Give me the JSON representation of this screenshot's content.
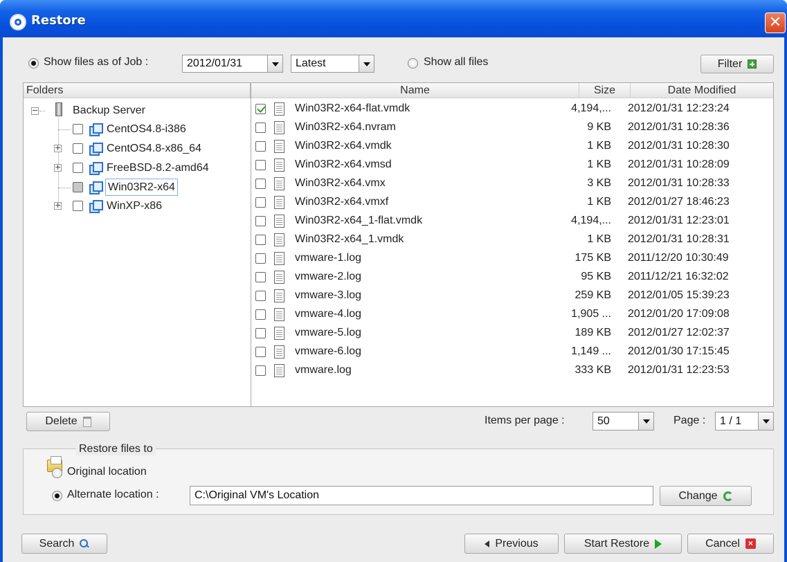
{
  "window": {
    "title": "Restore",
    "close_symbol": "✕"
  },
  "toolbar": {
    "show_files_as_of_job_label": "Show files as of Job :",
    "job_date": "2012/01/31",
    "version": "Latest",
    "show_all_files_label": "Show all files",
    "filter_label": "Filter"
  },
  "folders": {
    "header": "Folders",
    "root": "Backup Server",
    "items": [
      {
        "label": "CentOS4.8-i386",
        "expandable": false,
        "state": "unchecked"
      },
      {
        "label": "CentOS4.8-x86_64",
        "expandable": true,
        "state": "unchecked"
      },
      {
        "label": "FreeBSD-8.2-amd64",
        "expandable": true,
        "state": "unchecked"
      },
      {
        "label": "Win03R2-x64",
        "expandable": false,
        "state": "partial",
        "selected": true
      },
      {
        "label": "WinXP-x86",
        "expandable": true,
        "state": "unchecked"
      }
    ]
  },
  "files": {
    "columns": {
      "name": "Name",
      "size": "Size",
      "date": "Date Modified"
    },
    "rows": [
      {
        "name": "Win03R2-x64-flat.vmdk",
        "size": "4,194,...",
        "date": "2012/01/31 12:23:24",
        "checked": true
      },
      {
        "name": "Win03R2-x64.nvram",
        "size": "9 KB",
        "date": "2012/01/31 10:28:36",
        "checked": false
      },
      {
        "name": "Win03R2-x64.vmdk",
        "size": "1 KB",
        "date": "2012/01/31 10:28:30",
        "checked": false
      },
      {
        "name": "Win03R2-x64.vmsd",
        "size": "1 KB",
        "date": "2012/01/31 10:28:09",
        "checked": false
      },
      {
        "name": "Win03R2-x64.vmx",
        "size": "3 KB",
        "date": "2012/01/31 10:28:33",
        "checked": false
      },
      {
        "name": "Win03R2-x64.vmxf",
        "size": "1 KB",
        "date": "2012/01/27 18:46:23",
        "checked": false
      },
      {
        "name": "Win03R2-x64_1-flat.vmdk",
        "size": "4,194,...",
        "date": "2012/01/31 12:23:01",
        "checked": false
      },
      {
        "name": "Win03R2-x64_1.vmdk",
        "size": "1 KB",
        "date": "2012/01/31 10:28:31",
        "checked": false
      },
      {
        "name": "vmware-1.log",
        "size": "175 KB",
        "date": "2011/12/20 10:30:49",
        "checked": false
      },
      {
        "name": "vmware-2.log",
        "size": "95 KB",
        "date": "2011/12/21 16:32:02",
        "checked": false
      },
      {
        "name": "vmware-3.log",
        "size": "259 KB",
        "date": "2012/01/05 15:39:23",
        "checked": false
      },
      {
        "name": "vmware-4.log",
        "size": "1,905 ...",
        "date": "2012/01/20 17:09:08",
        "checked": false
      },
      {
        "name": "vmware-5.log",
        "size": "189 KB",
        "date": "2012/01/27 12:02:37",
        "checked": false
      },
      {
        "name": "vmware-6.log",
        "size": "1,149 ...",
        "date": "2012/01/30 17:15:45",
        "checked": false
      },
      {
        "name": "vmware.log",
        "size": "333 KB",
        "date": "2012/01/31 12:23:53",
        "checked": false
      }
    ]
  },
  "pager": {
    "delete_label": "Delete",
    "items_per_page_label": "Items per page :",
    "items_per_page": "50",
    "page_label": "Page :",
    "page_value": "1 / 1"
  },
  "restore_to": {
    "section_label": "Restore files to",
    "original_label": "Original location",
    "alternate_label": "Alternate location :",
    "alternate_path": "C:\\Original VM's Location",
    "change_label": "Change"
  },
  "footer": {
    "search_label": "Search",
    "previous_label": "Previous",
    "start_restore_label": "Start Restore",
    "cancel_label": "Cancel"
  }
}
